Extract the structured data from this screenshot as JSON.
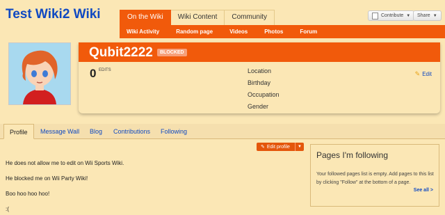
{
  "wiki": {
    "title": "Test Wiki2 Wiki"
  },
  "nav": {
    "tabs": [
      "On the Wiki",
      "Wiki Content",
      "Community"
    ],
    "active_tab": "On the Wiki",
    "subnav": [
      "Wiki Activity",
      "Random page",
      "Videos",
      "Photos",
      "Forum"
    ]
  },
  "header_buttons": {
    "contribute": "Contribute",
    "share": "Share"
  },
  "profile": {
    "username": "Qubit2222",
    "badge": "BLOCKED",
    "edits_count": "0",
    "edits_label": "EDITS",
    "fields": [
      "Location",
      "Birthday",
      "Occupation",
      "Gender"
    ],
    "edit_label": "Edit"
  },
  "profile_tabs": [
    "Profile",
    "Message Wall",
    "Blog",
    "Contributions",
    "Following"
  ],
  "edit_profile_label": "Edit profile",
  "post_lines": [
    "He does not allow me to edit on Wii Sports Wiki.",
    "He blocked me on Wii Party Wiki!",
    "Boo hoo hoo hoo!",
    ":("
  ],
  "rail": {
    "title": "Pages I'm following",
    "text": "Your followed pages list is empty. Add pages to this list by clicking \"Follow\" at the bottom of a page.",
    "see_all": "See all >"
  },
  "colors": {
    "accent": "#f15a0b",
    "link": "#0f49c2",
    "background": "#fbe7b5"
  }
}
